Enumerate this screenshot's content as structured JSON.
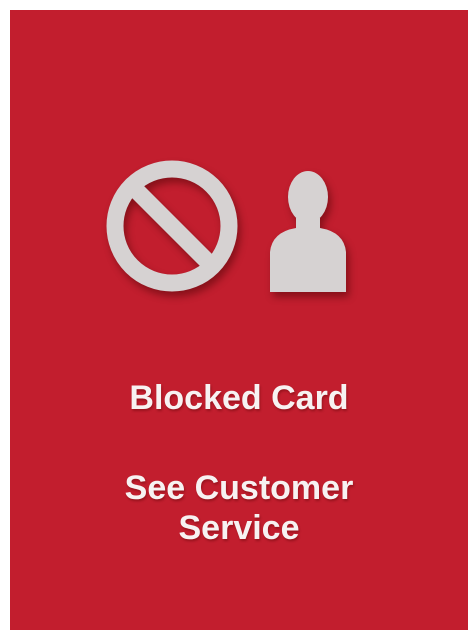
{
  "colors": {
    "background": "#c21e2e",
    "icon": "#d6d2d2",
    "text": "#f7f2f2"
  },
  "icons": {
    "blocked": "prohibited-icon",
    "person": "person-icon"
  },
  "message": {
    "title": "Blocked Card",
    "subtitle_line1": "See Customer",
    "subtitle_line2": "Service"
  }
}
